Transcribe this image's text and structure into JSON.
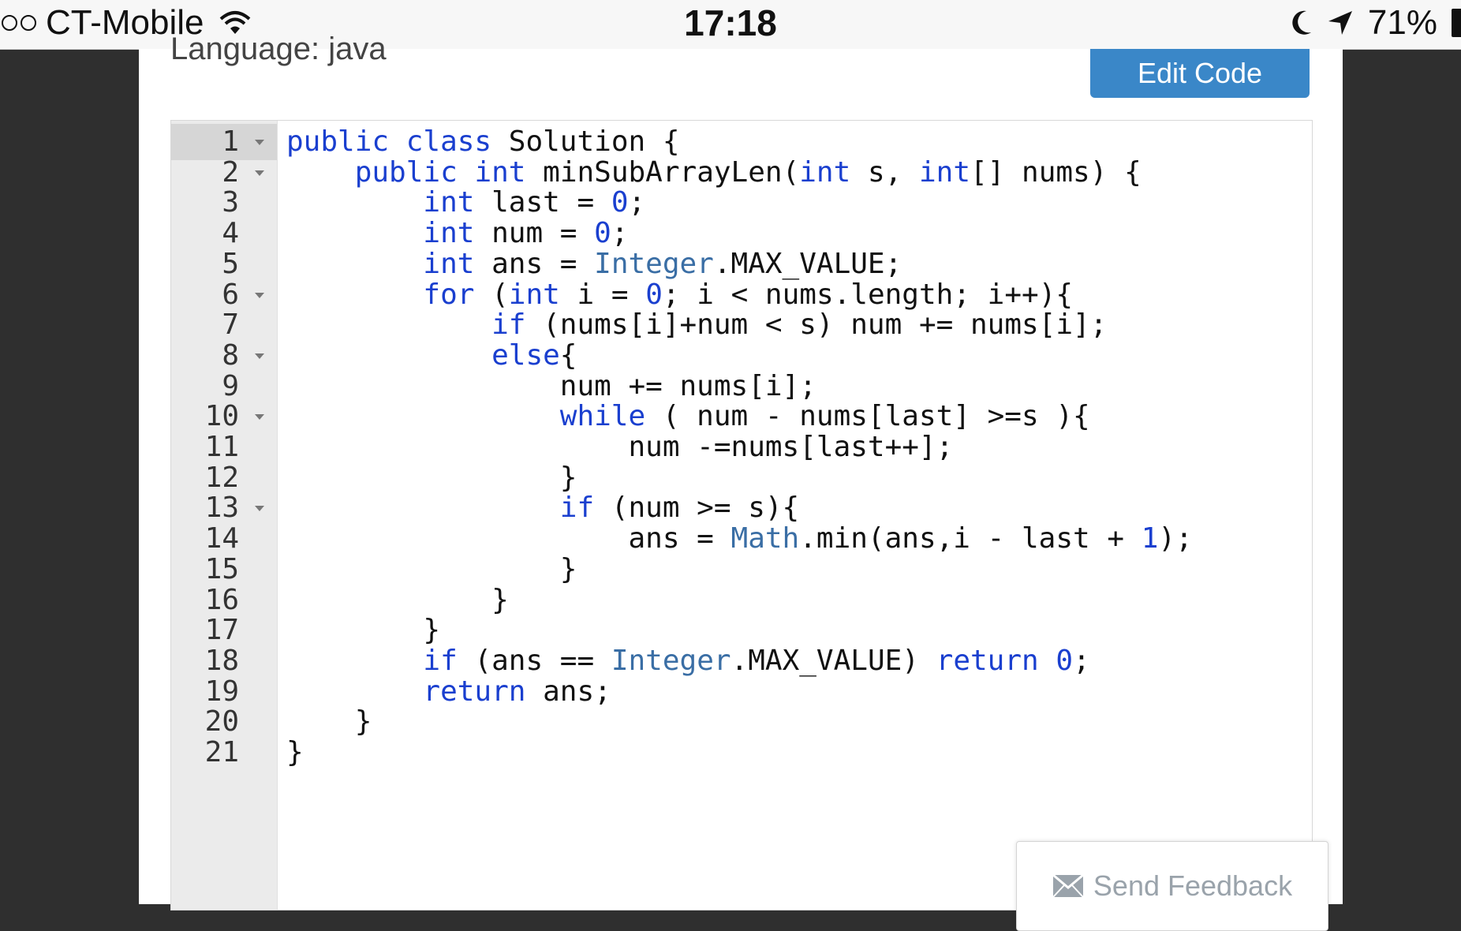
{
  "status_bar": {
    "carrier": "CT-Mobile",
    "time": "17:18",
    "battery": "71%"
  },
  "page": {
    "language_label": "Language: java",
    "edit_button_label": "Edit Code",
    "feedback_label": "Send Feedback"
  },
  "editor": {
    "lines": [
      {
        "n": "1",
        "fold": true,
        "tokens": [
          [
            "kw",
            "public"
          ],
          [
            "t",
            " "
          ],
          [
            "kw",
            "class"
          ],
          [
            "t",
            " Solution {"
          ]
        ]
      },
      {
        "n": "2",
        "fold": true,
        "tokens": [
          [
            "t",
            "    "
          ],
          [
            "kw",
            "public"
          ],
          [
            "t",
            " "
          ],
          [
            "kw",
            "int"
          ],
          [
            "t",
            " minSubArrayLen("
          ],
          [
            "kw",
            "int"
          ],
          [
            "t",
            " s, "
          ],
          [
            "kw",
            "int"
          ],
          [
            "t",
            "[] nums) {"
          ]
        ]
      },
      {
        "n": "3",
        "fold": false,
        "tokens": [
          [
            "t",
            "        "
          ],
          [
            "kw",
            "int"
          ],
          [
            "t",
            " last = "
          ],
          [
            "num",
            "0"
          ],
          [
            "t",
            ";"
          ]
        ]
      },
      {
        "n": "4",
        "fold": false,
        "tokens": [
          [
            "t",
            "        "
          ],
          [
            "kw",
            "int"
          ],
          [
            "t",
            " num = "
          ],
          [
            "num",
            "0"
          ],
          [
            "t",
            ";"
          ]
        ]
      },
      {
        "n": "5",
        "fold": false,
        "tokens": [
          [
            "t",
            "        "
          ],
          [
            "kw",
            "int"
          ],
          [
            "t",
            " ans = "
          ],
          [
            "cls",
            "Integer"
          ],
          [
            "t",
            ".MAX_VALUE;"
          ]
        ]
      },
      {
        "n": "6",
        "fold": true,
        "tokens": [
          [
            "t",
            "        "
          ],
          [
            "kw",
            "for"
          ],
          [
            "t",
            " ("
          ],
          [
            "kw",
            "int"
          ],
          [
            "t",
            " i = "
          ],
          [
            "num",
            "0"
          ],
          [
            "t",
            "; i < nums.length; i++){"
          ]
        ]
      },
      {
        "n": "7",
        "fold": false,
        "tokens": [
          [
            "t",
            "            "
          ],
          [
            "kw",
            "if"
          ],
          [
            "t",
            " (nums[i]+num < s) num += nums[i];"
          ]
        ]
      },
      {
        "n": "8",
        "fold": true,
        "tokens": [
          [
            "t",
            "            "
          ],
          [
            "kw",
            "else"
          ],
          [
            "t",
            "{"
          ]
        ]
      },
      {
        "n": "9",
        "fold": false,
        "tokens": [
          [
            "t",
            "                num += nums[i];"
          ]
        ]
      },
      {
        "n": "10",
        "fold": true,
        "tokens": [
          [
            "t",
            "                "
          ],
          [
            "kw",
            "while"
          ],
          [
            "t",
            " ( num - nums[last] >=s ){"
          ]
        ]
      },
      {
        "n": "11",
        "fold": false,
        "tokens": [
          [
            "t",
            "                    num -=nums[last++];"
          ]
        ]
      },
      {
        "n": "12",
        "fold": false,
        "tokens": [
          [
            "t",
            "                }"
          ]
        ]
      },
      {
        "n": "13",
        "fold": true,
        "tokens": [
          [
            "t",
            "                "
          ],
          [
            "kw",
            "if"
          ],
          [
            "t",
            " (num >= s){"
          ]
        ]
      },
      {
        "n": "14",
        "fold": false,
        "tokens": [
          [
            "t",
            "                    ans = "
          ],
          [
            "cls",
            "Math"
          ],
          [
            "t",
            ".min(ans,i - last + "
          ],
          [
            "num",
            "1"
          ],
          [
            "t",
            ");"
          ]
        ]
      },
      {
        "n": "15",
        "fold": false,
        "tokens": [
          [
            "t",
            "                }"
          ]
        ]
      },
      {
        "n": "16",
        "fold": false,
        "tokens": [
          [
            "t",
            "            }"
          ]
        ]
      },
      {
        "n": "17",
        "fold": false,
        "tokens": [
          [
            "t",
            "        }"
          ]
        ]
      },
      {
        "n": "18",
        "fold": false,
        "tokens": [
          [
            "t",
            "        "
          ],
          [
            "kw",
            "if"
          ],
          [
            "t",
            " (ans == "
          ],
          [
            "cls",
            "Integer"
          ],
          [
            "t",
            ".MAX_VALUE) "
          ],
          [
            "kw",
            "return"
          ],
          [
            "t",
            " "
          ],
          [
            "num",
            "0"
          ],
          [
            "t",
            ";"
          ]
        ]
      },
      {
        "n": "19",
        "fold": false,
        "tokens": [
          [
            "t",
            "        "
          ],
          [
            "kw",
            "return"
          ],
          [
            "t",
            " ans;"
          ]
        ]
      },
      {
        "n": "20",
        "fold": false,
        "tokens": [
          [
            "t",
            "    }"
          ]
        ]
      },
      {
        "n": "21",
        "fold": false,
        "tokens": [
          [
            "t",
            "}"
          ]
        ]
      }
    ]
  }
}
